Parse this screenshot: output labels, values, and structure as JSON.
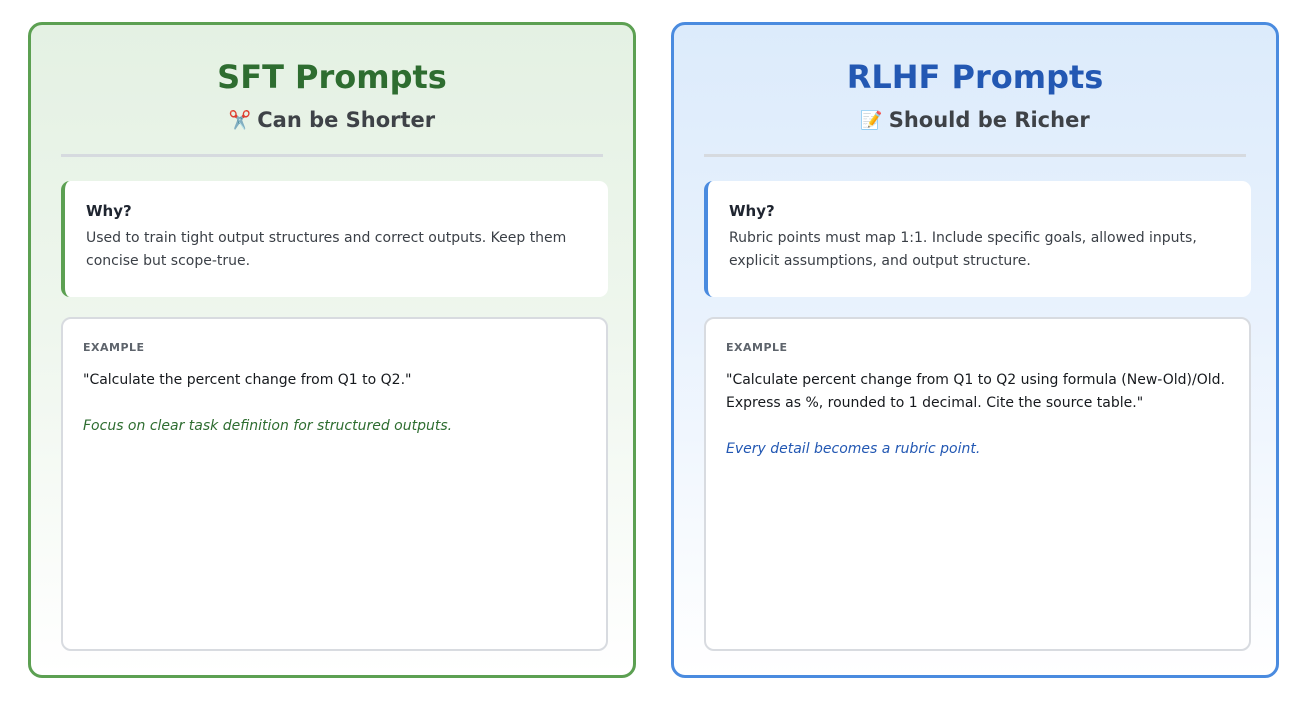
{
  "panels": {
    "sft": {
      "title": "SFT Prompts",
      "subtitle_icon": "✂️",
      "subtitle": "Can be Shorter",
      "why_title": "Why?",
      "why_text": "Used to train tight output structures and correct outputs. Keep them concise but scope-true.",
      "example_label": "EXAMPLE",
      "example_quote": "\"Calculate the percent change from Q1 to Q2.\"",
      "example_note": "Focus on clear task definition for structured outputs.",
      "accent_color": "#5ca052",
      "title_color": "#2e6d30"
    },
    "rlhf": {
      "title": "RLHF Prompts",
      "subtitle_icon": "📝",
      "subtitle": "Should be Richer",
      "why_title": "Why?",
      "why_text": "Rubric points must map 1:1. Include specific goals, allowed inputs, explicit assumptions, and output structure.",
      "example_label": "EXAMPLE",
      "example_quote": "\"Calculate percent change from Q1 to Q2 using formula (New-Old)/Old. Express as %, rounded to 1 decimal. Cite the source table.\"",
      "example_note": "Every detail becomes a rubric point.",
      "accent_color": "#4a8bdf",
      "title_color": "#2358b3"
    }
  }
}
